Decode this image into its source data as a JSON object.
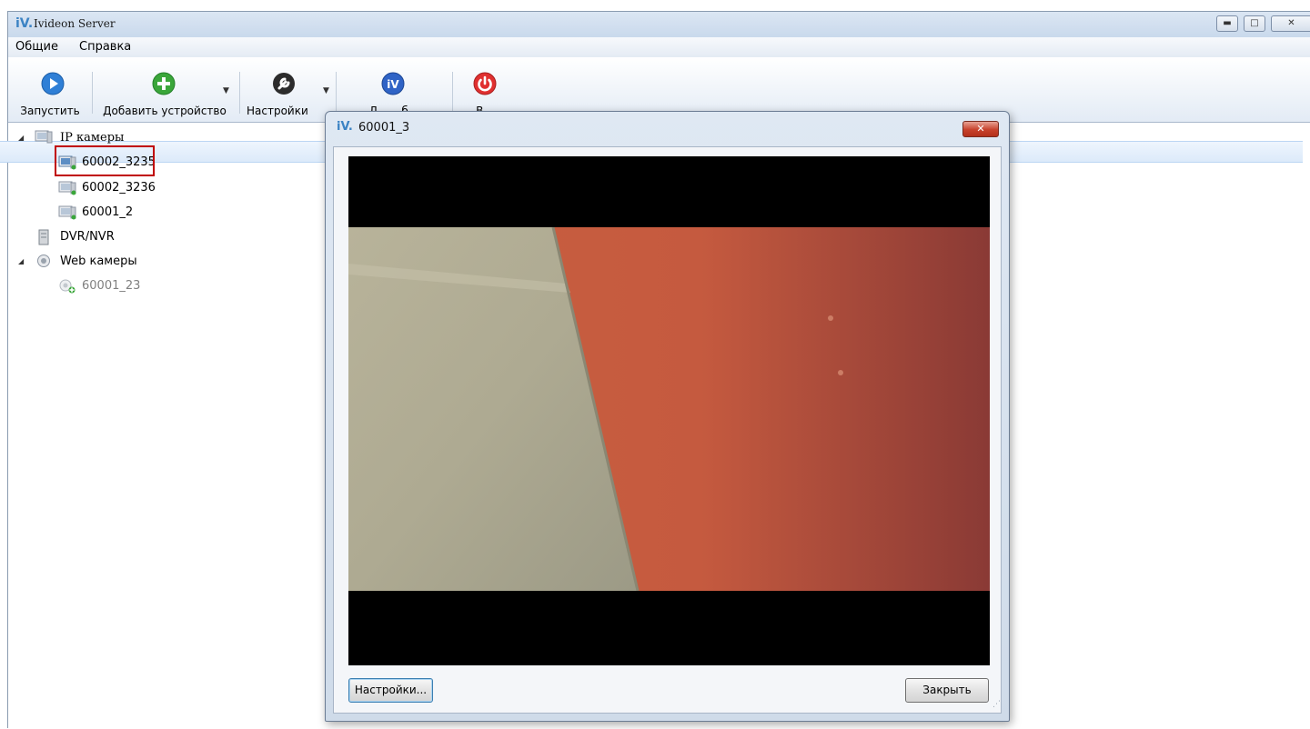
{
  "window": {
    "title": "Ivideon Server",
    "logo_text": "iV.",
    "controls": [
      "minimize-icon",
      "maximize-icon",
      "close-icon"
    ]
  },
  "menu": [
    "Общие",
    "Справка"
  ],
  "toolbar": {
    "buttons": [
      {
        "label": "Запустить",
        "icon": "play-icon",
        "color": "#2f7fd6"
      },
      {
        "label": "Добавить устройство",
        "icon": "add-icon",
        "color": "#3aa63a",
        "has_dropdown": true
      },
      {
        "label": "Настройки",
        "icon": "wrench-icon",
        "color": "#333333",
        "has_dropdown": true
      },
      {
        "label": "Л... ...б...",
        "icon": "ivideon-icon",
        "color": "#2f63c6"
      },
      {
        "label": "В...",
        "icon": "power-icon",
        "color": "#e03030"
      }
    ]
  },
  "tree": {
    "groups": [
      {
        "label": "IP камеры",
        "expanded": true,
        "icon": "ip-camera-group-icon",
        "items": [
          {
            "label": "60002_3235",
            "selected": true,
            "icon": "ip-camera-icon"
          },
          {
            "label": "60002_3236",
            "icon": "ip-camera-icon"
          },
          {
            "label": "60001_2",
            "icon": "ip-camera-icon"
          }
        ]
      },
      {
        "label": "DVR/NVR",
        "expanded": false,
        "icon": "dvr-icon",
        "items": []
      },
      {
        "label": "Web камеры",
        "expanded": true,
        "icon": "webcam-icon",
        "items": [
          {
            "label": "60001_23",
            "disabled": true,
            "icon": "webcam-add-icon"
          }
        ]
      }
    ]
  },
  "dialog": {
    "logo_text": "iV.",
    "title": "60001_3",
    "settings_button": "Настройки...",
    "close_button": "Закрыть",
    "video": "live-camera-preview"
  },
  "colors": {
    "selection_highlight": "#c00000",
    "dialog_close": "#c7412b"
  }
}
